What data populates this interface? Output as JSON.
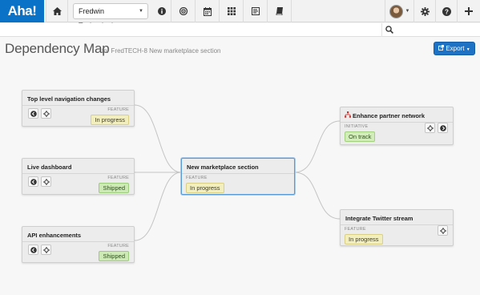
{
  "app": {
    "logo": "Aha!"
  },
  "nav": {
    "workspace": "Fredwin Technologies",
    "icons": [
      "home-icon",
      "info-icon",
      "target-icon",
      "calendar-icon",
      "grid-icon",
      "list-icon",
      "book-icon"
    ],
    "right_icons": [
      "avatar",
      "settings-icon",
      "help-icon",
      "add-icon"
    ]
  },
  "search": {
    "value": "",
    "placeholder": ""
  },
  "header": {
    "title": "Dependency Map",
    "subtitle": "for FredTECH-8 New marketplace section",
    "export_label": "Export"
  },
  "colors": {
    "brand": "#0a73c8",
    "in_progress": "#f3eebe",
    "shipped": "#cde9b5",
    "selected_border": "#5b9bd5"
  },
  "cards": {
    "top_nav": {
      "title": "Top level navigation changes",
      "type": "FEATURE",
      "status": "In progress"
    },
    "live_dashboard": {
      "title": "Live dashboard",
      "type": "FEATURE",
      "status": "Shipped"
    },
    "api": {
      "title": "API enhancements",
      "type": "FEATURE",
      "status": "Shipped"
    },
    "center": {
      "title": "New marketplace section",
      "type": "FEATURE",
      "status": "In progress"
    },
    "partner": {
      "title": "Enhance partner network",
      "type": "INITIATIVE",
      "status": "On track"
    },
    "twitter": {
      "title": "Integrate Twitter stream",
      "type": "FEATURE",
      "status": "In progress"
    }
  }
}
